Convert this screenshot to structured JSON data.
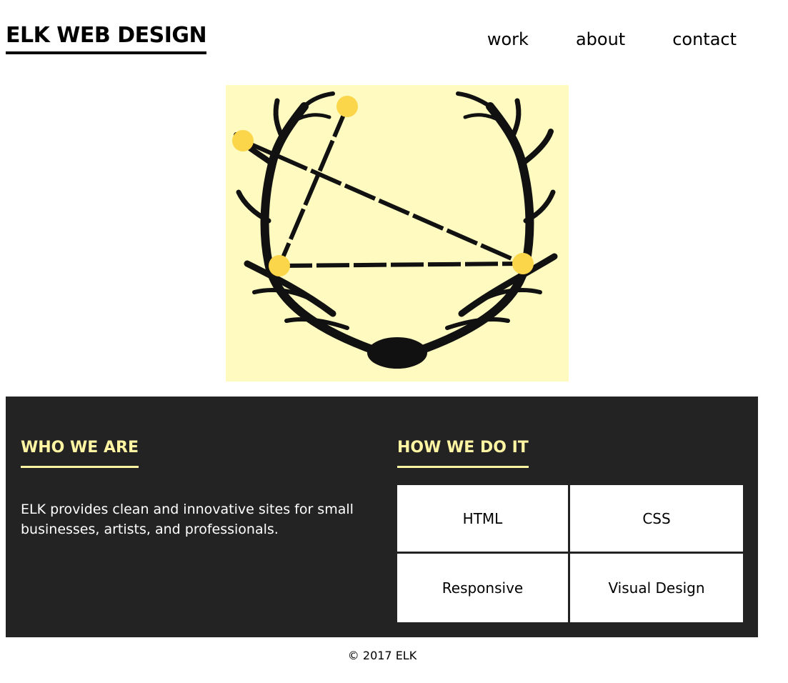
{
  "header": {
    "logo": "ELK WEB DESIGN",
    "nav": [
      "work",
      "about",
      "contact"
    ]
  },
  "hero": {
    "image": "elk-antlers-illustration",
    "background": "#fffbc0",
    "dot_color": "#fcd64a"
  },
  "who": {
    "heading": "WHO WE ARE",
    "text": "ELK provides clean and innovative sites for small businesses, artists, and professionals."
  },
  "how": {
    "heading": "HOW WE DO IT",
    "items": [
      "HTML",
      "CSS",
      "Responsive",
      "Visual Design"
    ]
  },
  "footer": {
    "text": "© 2017 ELK"
  },
  "colors": {
    "panel": "#232323",
    "accent": "#fff5a3"
  }
}
